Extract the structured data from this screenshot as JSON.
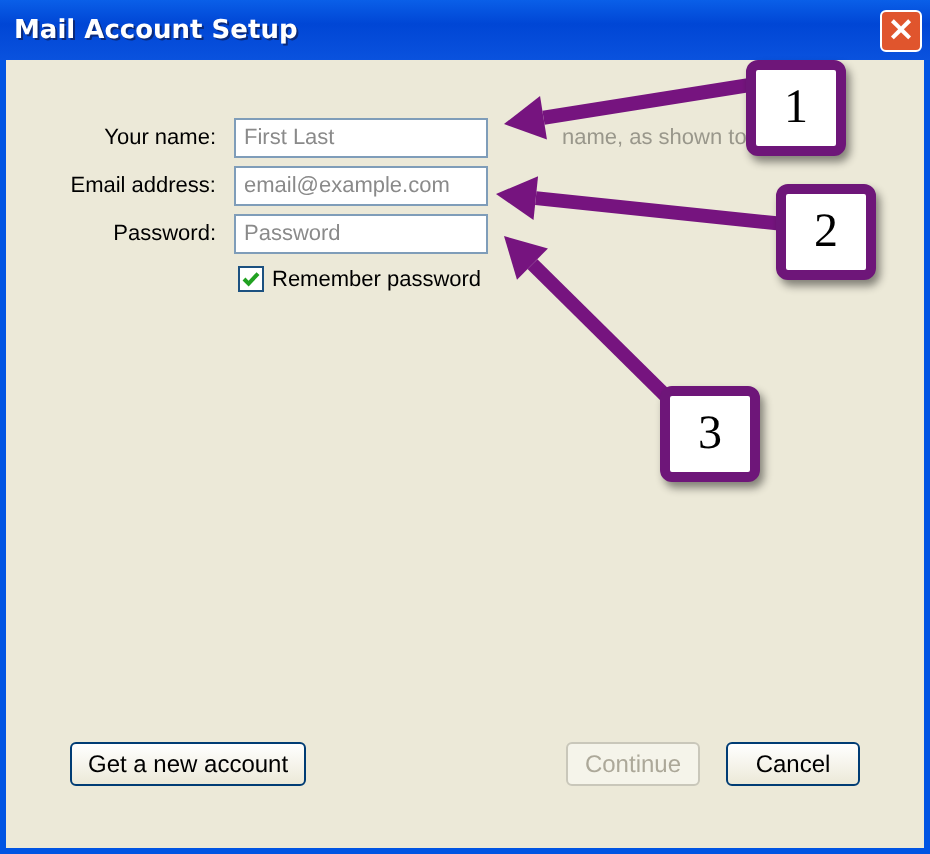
{
  "window": {
    "title": "Mail Account Setup",
    "close_icon": "×"
  },
  "fields": [
    {
      "label": "Your name:",
      "placeholder": "First Last",
      "hint": "name, as shown to"
    },
    {
      "label": "Email address:",
      "placeholder": "email@example.com"
    },
    {
      "label": "Password:",
      "placeholder": "Password"
    }
  ],
  "remember_password": {
    "label": "Remember password",
    "checked": true
  },
  "buttons": [
    {
      "label": "Get a new account",
      "disabled": false
    },
    {
      "label": "Continue",
      "disabled": true
    },
    {
      "label": "Cancel",
      "disabled": false
    }
  ],
  "callouts": [
    {
      "number": "1"
    },
    {
      "number": "2"
    },
    {
      "number": "3"
    }
  ]
}
